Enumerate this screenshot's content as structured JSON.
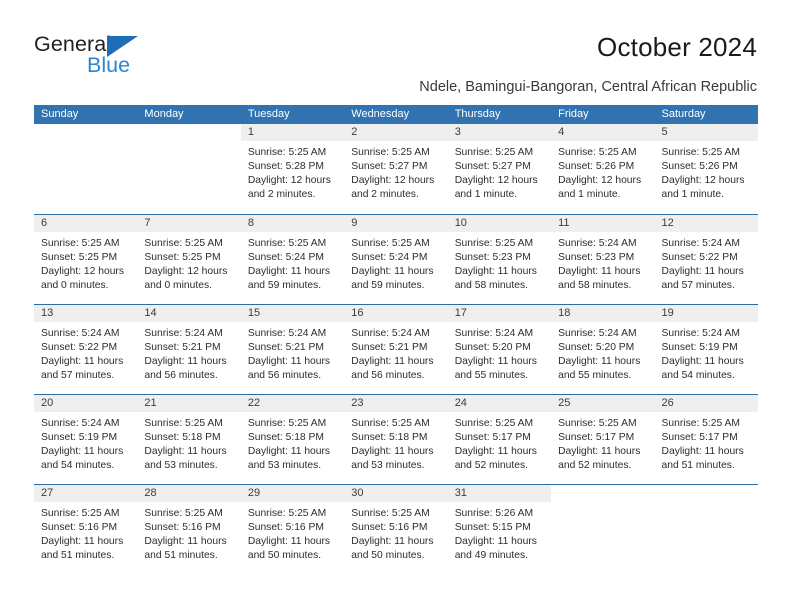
{
  "brand": {
    "name_part1": "General",
    "name_part2": "Blue",
    "triangle_icon": "triangle-icon",
    "accent_blue": "#2b87d0",
    "triangle_blue": "#1f6db5"
  },
  "header": {
    "month_title": "October 2024",
    "location": "Ndele, Bamingui-Bangoran, Central African Republic"
  },
  "calendar": {
    "header_color": "#3173b0",
    "banner_color": "#efefef",
    "separator_color": "#2d6da4",
    "weekdays": [
      "Sunday",
      "Monday",
      "Tuesday",
      "Wednesday",
      "Thursday",
      "Friday",
      "Saturday"
    ],
    "weeks": [
      [
        {
          "day": "",
          "blank": true,
          "sunrise": "",
          "sunset": "",
          "daylight_line1": "",
          "daylight_line2": ""
        },
        {
          "day": "",
          "blank": true,
          "sunrise": "",
          "sunset": "",
          "daylight_line1": "",
          "daylight_line2": ""
        },
        {
          "day": "1",
          "sunrise": "Sunrise: 5:25 AM",
          "sunset": "Sunset: 5:28 PM",
          "daylight_line1": "Daylight: 12 hours",
          "daylight_line2": "and 2 minutes."
        },
        {
          "day": "2",
          "sunrise": "Sunrise: 5:25 AM",
          "sunset": "Sunset: 5:27 PM",
          "daylight_line1": "Daylight: 12 hours",
          "daylight_line2": "and 2 minutes."
        },
        {
          "day": "3",
          "sunrise": "Sunrise: 5:25 AM",
          "sunset": "Sunset: 5:27 PM",
          "daylight_line1": "Daylight: 12 hours",
          "daylight_line2": "and 1 minute."
        },
        {
          "day": "4",
          "sunrise": "Sunrise: 5:25 AM",
          "sunset": "Sunset: 5:26 PM",
          "daylight_line1": "Daylight: 12 hours",
          "daylight_line2": "and 1 minute."
        },
        {
          "day": "5",
          "sunrise": "Sunrise: 5:25 AM",
          "sunset": "Sunset: 5:26 PM",
          "daylight_line1": "Daylight: 12 hours",
          "daylight_line2": "and 1 minute."
        }
      ],
      [
        {
          "day": "6",
          "sunrise": "Sunrise: 5:25 AM",
          "sunset": "Sunset: 5:25 PM",
          "daylight_line1": "Daylight: 12 hours",
          "daylight_line2": "and 0 minutes."
        },
        {
          "day": "7",
          "sunrise": "Sunrise: 5:25 AM",
          "sunset": "Sunset: 5:25 PM",
          "daylight_line1": "Daylight: 12 hours",
          "daylight_line2": "and 0 minutes."
        },
        {
          "day": "8",
          "sunrise": "Sunrise: 5:25 AM",
          "sunset": "Sunset: 5:24 PM",
          "daylight_line1": "Daylight: 11 hours",
          "daylight_line2": "and 59 minutes."
        },
        {
          "day": "9",
          "sunrise": "Sunrise: 5:25 AM",
          "sunset": "Sunset: 5:24 PM",
          "daylight_line1": "Daylight: 11 hours",
          "daylight_line2": "and 59 minutes."
        },
        {
          "day": "10",
          "sunrise": "Sunrise: 5:25 AM",
          "sunset": "Sunset: 5:23 PM",
          "daylight_line1": "Daylight: 11 hours",
          "daylight_line2": "and 58 minutes."
        },
        {
          "day": "11",
          "sunrise": "Sunrise: 5:24 AM",
          "sunset": "Sunset: 5:23 PM",
          "daylight_line1": "Daylight: 11 hours",
          "daylight_line2": "and 58 minutes."
        },
        {
          "day": "12",
          "sunrise": "Sunrise: 5:24 AM",
          "sunset": "Sunset: 5:22 PM",
          "daylight_line1": "Daylight: 11 hours",
          "daylight_line2": "and 57 minutes."
        }
      ],
      [
        {
          "day": "13",
          "sunrise": "Sunrise: 5:24 AM",
          "sunset": "Sunset: 5:22 PM",
          "daylight_line1": "Daylight: 11 hours",
          "daylight_line2": "and 57 minutes."
        },
        {
          "day": "14",
          "sunrise": "Sunrise: 5:24 AM",
          "sunset": "Sunset: 5:21 PM",
          "daylight_line1": "Daylight: 11 hours",
          "daylight_line2": "and 56 minutes."
        },
        {
          "day": "15",
          "sunrise": "Sunrise: 5:24 AM",
          "sunset": "Sunset: 5:21 PM",
          "daylight_line1": "Daylight: 11 hours",
          "daylight_line2": "and 56 minutes."
        },
        {
          "day": "16",
          "sunrise": "Sunrise: 5:24 AM",
          "sunset": "Sunset: 5:21 PM",
          "daylight_line1": "Daylight: 11 hours",
          "daylight_line2": "and 56 minutes."
        },
        {
          "day": "17",
          "sunrise": "Sunrise: 5:24 AM",
          "sunset": "Sunset: 5:20 PM",
          "daylight_line1": "Daylight: 11 hours",
          "daylight_line2": "and 55 minutes."
        },
        {
          "day": "18",
          "sunrise": "Sunrise: 5:24 AM",
          "sunset": "Sunset: 5:20 PM",
          "daylight_line1": "Daylight: 11 hours",
          "daylight_line2": "and 55 minutes."
        },
        {
          "day": "19",
          "sunrise": "Sunrise: 5:24 AM",
          "sunset": "Sunset: 5:19 PM",
          "daylight_line1": "Daylight: 11 hours",
          "daylight_line2": "and 54 minutes."
        }
      ],
      [
        {
          "day": "20",
          "sunrise": "Sunrise: 5:24 AM",
          "sunset": "Sunset: 5:19 PM",
          "daylight_line1": "Daylight: 11 hours",
          "daylight_line2": "and 54 minutes."
        },
        {
          "day": "21",
          "sunrise": "Sunrise: 5:25 AM",
          "sunset": "Sunset: 5:18 PM",
          "daylight_line1": "Daylight: 11 hours",
          "daylight_line2": "and 53 minutes."
        },
        {
          "day": "22",
          "sunrise": "Sunrise: 5:25 AM",
          "sunset": "Sunset: 5:18 PM",
          "daylight_line1": "Daylight: 11 hours",
          "daylight_line2": "and 53 minutes."
        },
        {
          "day": "23",
          "sunrise": "Sunrise: 5:25 AM",
          "sunset": "Sunset: 5:18 PM",
          "daylight_line1": "Daylight: 11 hours",
          "daylight_line2": "and 53 minutes."
        },
        {
          "day": "24",
          "sunrise": "Sunrise: 5:25 AM",
          "sunset": "Sunset: 5:17 PM",
          "daylight_line1": "Daylight: 11 hours",
          "daylight_line2": "and 52 minutes."
        },
        {
          "day": "25",
          "sunrise": "Sunrise: 5:25 AM",
          "sunset": "Sunset: 5:17 PM",
          "daylight_line1": "Daylight: 11 hours",
          "daylight_line2": "and 52 minutes."
        },
        {
          "day": "26",
          "sunrise": "Sunrise: 5:25 AM",
          "sunset": "Sunset: 5:17 PM",
          "daylight_line1": "Daylight: 11 hours",
          "daylight_line2": "and 51 minutes."
        }
      ],
      [
        {
          "day": "27",
          "sunrise": "Sunrise: 5:25 AM",
          "sunset": "Sunset: 5:16 PM",
          "daylight_line1": "Daylight: 11 hours",
          "daylight_line2": "and 51 minutes."
        },
        {
          "day": "28",
          "sunrise": "Sunrise: 5:25 AM",
          "sunset": "Sunset: 5:16 PM",
          "daylight_line1": "Daylight: 11 hours",
          "daylight_line2": "and 51 minutes."
        },
        {
          "day": "29",
          "sunrise": "Sunrise: 5:25 AM",
          "sunset": "Sunset: 5:16 PM",
          "daylight_line1": "Daylight: 11 hours",
          "daylight_line2": "and 50 minutes."
        },
        {
          "day": "30",
          "sunrise": "Sunrise: 5:25 AM",
          "sunset": "Sunset: 5:16 PM",
          "daylight_line1": "Daylight: 11 hours",
          "daylight_line2": "and 50 minutes."
        },
        {
          "day": "31",
          "sunrise": "Sunrise: 5:26 AM",
          "sunset": "Sunset: 5:15 PM",
          "daylight_line1": "Daylight: 11 hours",
          "daylight_line2": "and 49 minutes."
        },
        {
          "day": "",
          "blank": true,
          "sunrise": "",
          "sunset": "",
          "daylight_line1": "",
          "daylight_line2": ""
        },
        {
          "day": "",
          "blank": true,
          "sunrise": "",
          "sunset": "",
          "daylight_line1": "",
          "daylight_line2": ""
        }
      ]
    ]
  }
}
